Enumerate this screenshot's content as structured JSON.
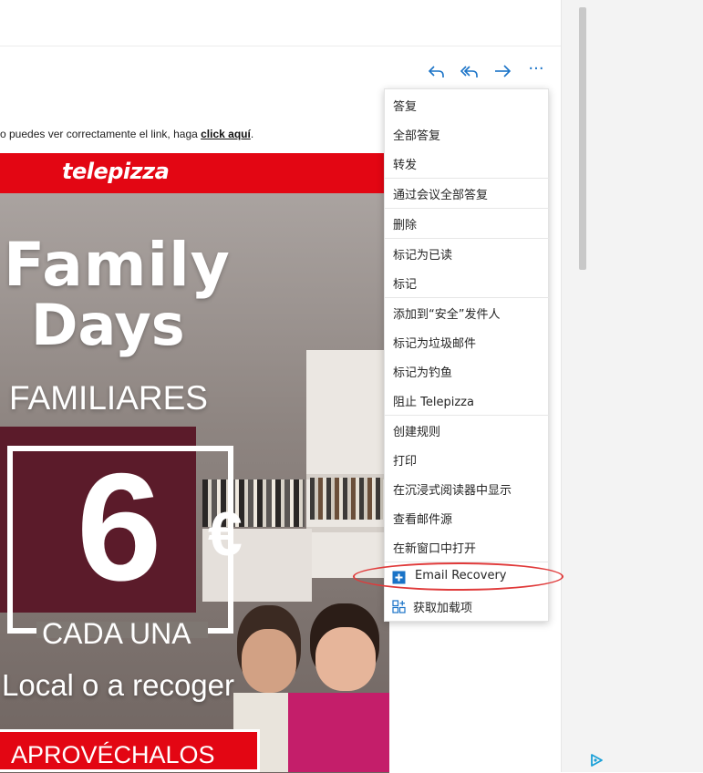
{
  "toolbar": {
    "reply_icon": "reply-icon",
    "reply_all_icon": "reply-all-icon",
    "forward_icon": "forward-icon",
    "more_icon": "more-icon",
    "more_glyph": "···",
    "accent_color": "#1a73c7"
  },
  "email": {
    "disclaimer_text": "o puedes ver correctamente el link, haga ",
    "disclaimer_link": "click aquí",
    "disclaimer_end": "."
  },
  "banner": {
    "brand": "telepizza",
    "headline_1": "Family",
    "headline_2": "Days",
    "subtitle": "FAMILIARES",
    "price": "6",
    "currency": "€",
    "per_unit": "CADA UNA",
    "delivery": "Local o a recoger",
    "cta": "APROVÉCHALOS",
    "brand_color": "#e30613",
    "price_box_color": "#5b1b2a"
  },
  "context_menu": {
    "groups": [
      [
        "答复",
        "全部答复",
        "转发"
      ],
      [
        "通过会议全部答复"
      ],
      [
        "删除"
      ],
      [
        "标记为已读",
        "标记"
      ],
      [
        "添加到“安全”发件人",
        "标记为垃圾邮件",
        "标记为钓鱼",
        "阻止 Telepizza"
      ],
      [
        "创建规则",
        "打印",
        "在沉浸式阅读器中显示",
        "查看邮件源",
        "在新窗口中打开"
      ],
      [
        "Email Recovery",
        "获取加载项"
      ]
    ],
    "addin_icons": {
      "Email Recovery": "email-recovery-icon",
      "获取加载项": "add-ins-icon"
    },
    "highlighted_item": "Email Recovery",
    "highlight_color": "#e03a3a"
  },
  "sidebar": {
    "ad_icon": "ad-choices-icon"
  }
}
